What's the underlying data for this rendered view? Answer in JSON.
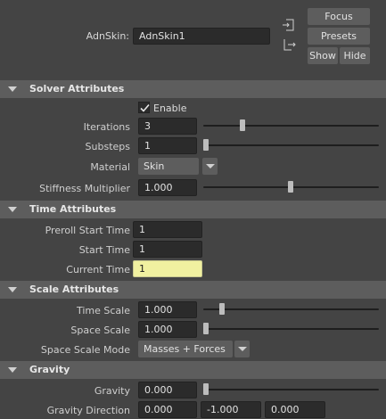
{
  "node": {
    "label": "AdnSkin:",
    "name": "AdnSkin1",
    "buttons": {
      "focus": "Focus",
      "presets": "Presets",
      "show": "Show",
      "hide": "Hide"
    }
  },
  "solver": {
    "title": "Solver Attributes",
    "enable_label": "Enable",
    "enable_checked": true,
    "iterations": {
      "label": "Iterations",
      "value": "3",
      "slider_fraction": 0.25
    },
    "substeps": {
      "label": "Substeps",
      "value": "1",
      "slider_fraction": 0.0
    },
    "material": {
      "label": "Material",
      "value": "Skin"
    },
    "stiffness": {
      "label": "Stiffness Multiplier",
      "value": "1.000",
      "slider_fraction": 0.5
    }
  },
  "time": {
    "title": "Time Attributes",
    "preroll": {
      "label": "Preroll Start Time",
      "value": "1"
    },
    "start": {
      "label": "Start Time",
      "value": "1"
    },
    "current": {
      "label": "Current Time",
      "value": "1"
    }
  },
  "scale": {
    "title": "Scale Attributes",
    "time_scale": {
      "label": "Time Scale",
      "value": "1.000",
      "slider_fraction": 0.1
    },
    "space_scale": {
      "label": "Space Scale",
      "value": "1.000",
      "slider_fraction": 0.0
    },
    "space_scale_mode": {
      "label": "Space Scale Mode",
      "value": "Masses + Forces"
    }
  },
  "gravity": {
    "title": "Gravity",
    "gravity": {
      "label": "Gravity",
      "value": "0.000",
      "slider_fraction": 0.0
    },
    "direction": {
      "label": "Gravity Direction",
      "x": "0.000",
      "y": "-1.000",
      "z": "0.000"
    }
  }
}
